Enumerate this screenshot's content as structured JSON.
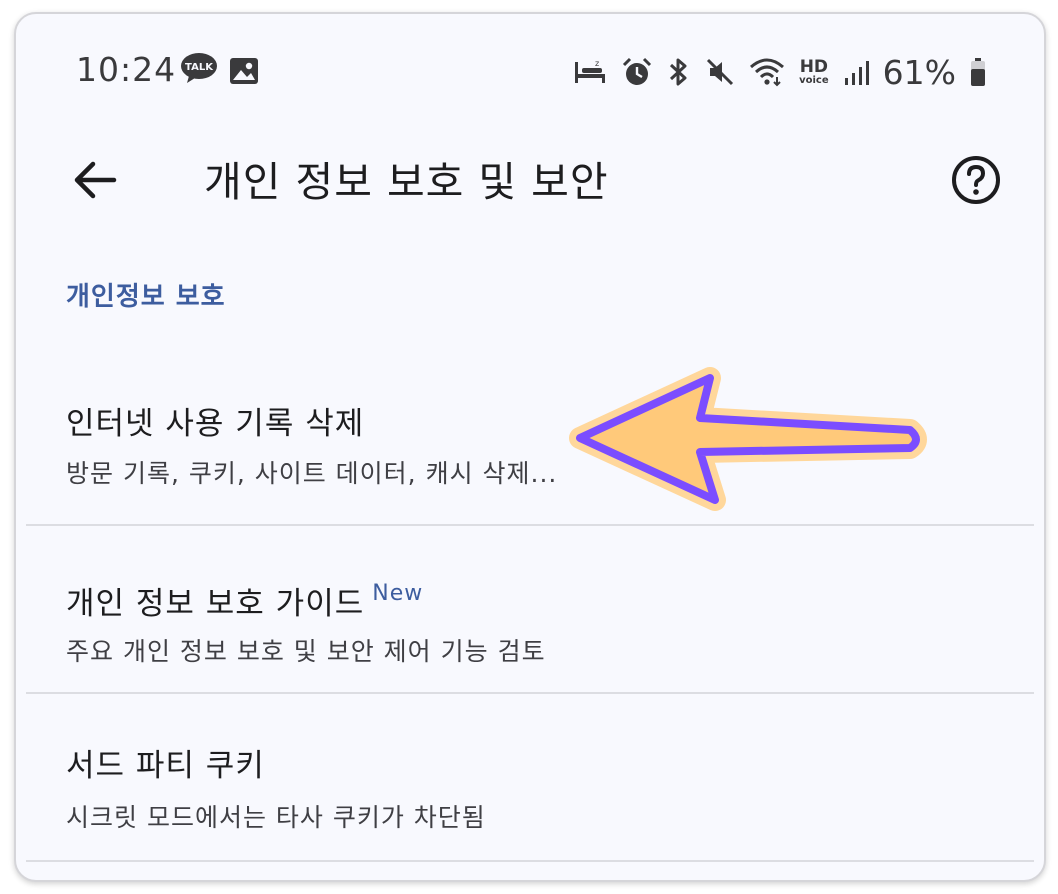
{
  "status_bar": {
    "time": "10:24",
    "talk_label": "TALK",
    "hd_top": "HD",
    "hd_bottom": "voice",
    "battery_percent": "61%",
    "icons": [
      "kakaotalk-icon",
      "gallery-icon",
      "sleep-bed-icon",
      "alarm-icon",
      "bluetooth-icon",
      "mute-icon",
      "wifi-icon",
      "hd-voice-icon",
      "signal-icon",
      "battery-icon"
    ]
  },
  "app_bar": {
    "title": "개인 정보 보호 및 보안",
    "back_icon": "arrow-left-icon",
    "help_icon": "help-circle-icon"
  },
  "section": {
    "header": "개인정보 보호"
  },
  "items": [
    {
      "title": "인터넷 사용 기록 삭제",
      "subtitle": "방문 기록, 쿠키, 사이트 데이터, 캐시 삭제..."
    },
    {
      "title": "개인 정보 보호 가이드",
      "badge": "New",
      "subtitle": "주요 개인 정보 보호 및 보안 제어 기능 검토"
    },
    {
      "title": "서드 파티 쿠키",
      "subtitle": "시크릿 모드에서는 타사 쿠키가 차단됨"
    }
  ],
  "colors": {
    "background": "#f8f9fe",
    "section_header": "#3d5d9f",
    "arrow_fill": "#ffc97a",
    "arrow_outline": "#7b4dff"
  }
}
